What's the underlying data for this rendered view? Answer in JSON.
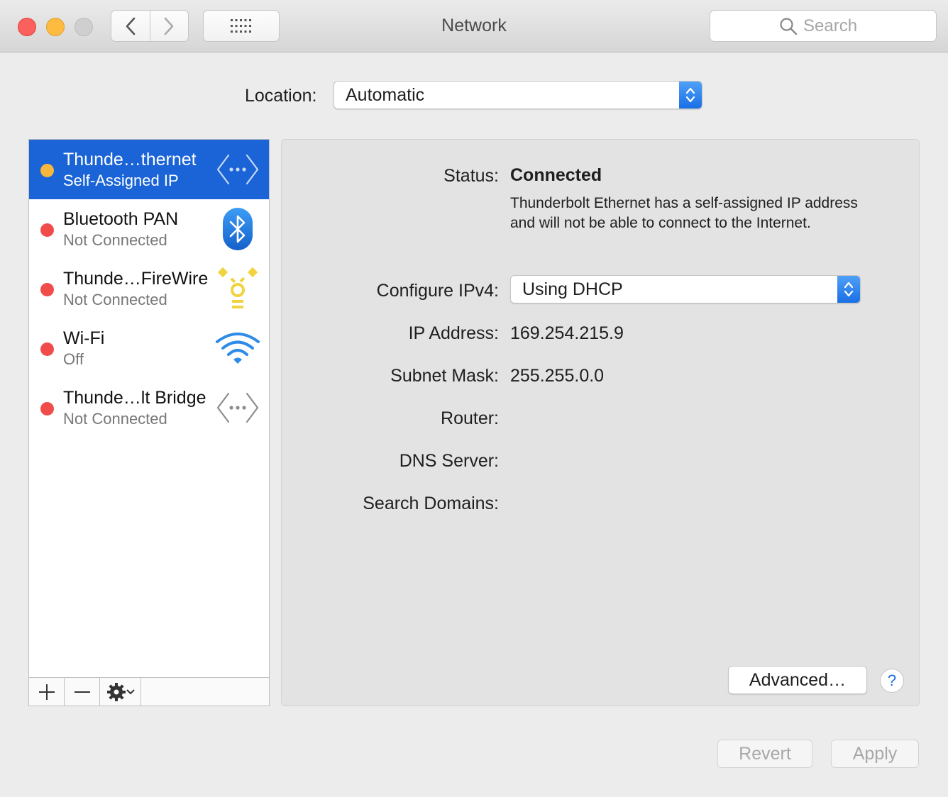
{
  "window": {
    "title": "Network",
    "search_placeholder": "Search"
  },
  "location": {
    "label": "Location:",
    "value": "Automatic"
  },
  "services": [
    {
      "name": "Thunde…thernet",
      "status": "Self-Assigned IP",
      "dot_color": "#f6b73c",
      "icon": "ethernet-arrows-icon",
      "selected": true
    },
    {
      "name": "Bluetooth PAN",
      "status": "Not Connected",
      "dot_color": "#f14c4c",
      "icon": "bluetooth-icon",
      "selected": false
    },
    {
      "name": "Thunde…FireWire",
      "status": "Not Connected",
      "dot_color": "#f14c4c",
      "icon": "firewire-icon",
      "selected": false
    },
    {
      "name": "Wi-Fi",
      "status": "Off",
      "dot_color": "#f14c4c",
      "icon": "wifi-icon",
      "selected": false
    },
    {
      "name": "Thunde…lt Bridge",
      "status": "Not Connected",
      "dot_color": "#f14c4c",
      "icon": "bridge-arrows-icon",
      "selected": false
    }
  ],
  "detail": {
    "status_label": "Status:",
    "status_value": "Connected",
    "status_description": "Thunderbolt Ethernet has a self-assigned IP address and will not be able to connect to the Internet.",
    "configure_label": "Configure IPv4:",
    "configure_value": "Using DHCP",
    "ip_label": "IP Address:",
    "ip_value": "169.254.215.9",
    "subnet_label": "Subnet Mask:",
    "subnet_value": "255.255.0.0",
    "router_label": "Router:",
    "router_value": "",
    "dns_label": "DNS Server:",
    "dns_value": "",
    "domains_label": "Search Domains:",
    "domains_value": "",
    "advanced_label": "Advanced…",
    "help_label": "?"
  },
  "footer": {
    "revert_label": "Revert",
    "apply_label": "Apply"
  },
  "colors": {
    "selection": "#1a64d7",
    "accent": "#1a6fe5"
  }
}
